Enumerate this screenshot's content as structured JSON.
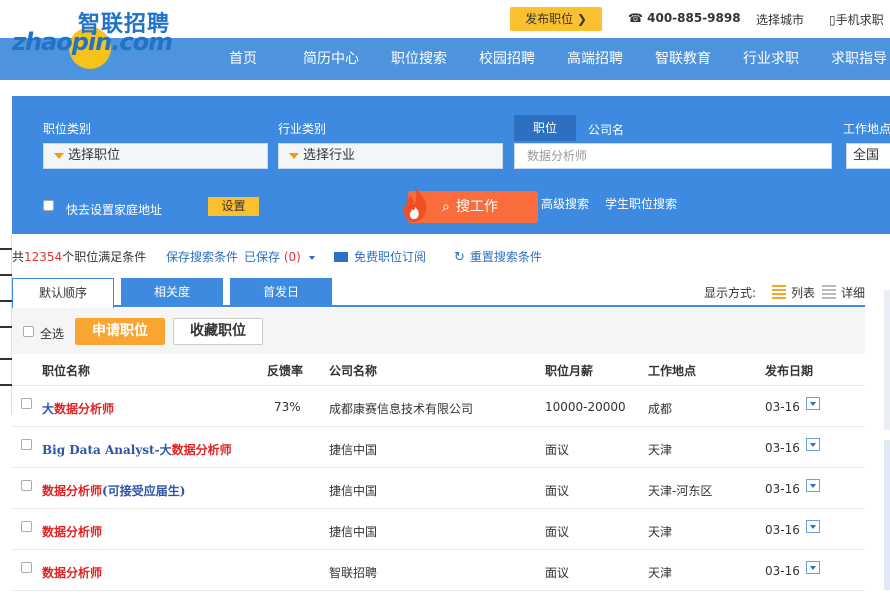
{
  "header": {
    "logo_cn": "智联招聘",
    "logo_en": "zhaopin.com",
    "post_job": "发布职位 ❯",
    "phone": "☎ 400-885-9898",
    "city": "选择城市",
    "mobile": "▯手机求职"
  },
  "nav": [
    "首页",
    "简历中心",
    "职位搜索",
    "校园招聘",
    "高端招聘",
    "智联教育",
    "行业求职",
    "求职指导"
  ],
  "search": {
    "job_category_label": "职位类别",
    "job_category_value": "选择职位",
    "industry_label": "行业类别",
    "industry_value": "选择行业",
    "tab_job": "职位",
    "tab_company": "公司名",
    "keyword_value": "数据分析师",
    "location_label": "工作地点",
    "location_value": "全国",
    "home_label": "快去设置家庭地址",
    "set_button": "设置",
    "search_button": "搜工作",
    "advanced": "高级搜索",
    "student": "学生职位搜索"
  },
  "summary": {
    "prefix": "共",
    "count": "12354",
    "suffix": "个职位满足条件",
    "save_condition": "保存搜索条件",
    "saved_label": "已保存",
    "saved_count": "(0)",
    "subscribe": "免费职位订阅",
    "reset": "重置搜索条件"
  },
  "tabs": [
    "默认顺序",
    "相关度",
    "首发日"
  ],
  "display": {
    "label": "显示方式:",
    "list": "列表",
    "detail": "详细"
  },
  "actions": {
    "select_all": "全选",
    "apply": "申请职位",
    "favorite": "收藏职位"
  },
  "table": {
    "headers": [
      "职位名称",
      "反馈率",
      "公司名称",
      "职位月薪",
      "工作地点",
      "发布日期"
    ],
    "rows": [
      {
        "title_pre": "大",
        "title_hl": "数据分析师",
        "title_post": "",
        "feedback": "73%",
        "company": "成都康赛信息技术有限公司",
        "salary": "10000-20000",
        "location": "成都",
        "date": "03-16"
      },
      {
        "title_pre": "Big Data Analyst-大",
        "title_hl": "数据分析师",
        "title_post": "",
        "feedback": "",
        "company": "捷信中国",
        "salary": "面议",
        "location": "天津",
        "date": "03-16"
      },
      {
        "title_pre": "",
        "title_hl": "数据分析师",
        "title_post": "(可接受应届生)",
        "feedback": "",
        "company": "捷信中国",
        "salary": "面议",
        "location": "天津-河东区",
        "date": "03-16"
      },
      {
        "title_pre": "",
        "title_hl": "数据分析师",
        "title_post": "",
        "feedback": "",
        "company": "捷信中国",
        "salary": "面议",
        "location": "天津",
        "date": "03-16"
      },
      {
        "title_pre": "",
        "title_hl": "数据分析师",
        "title_post": "",
        "feedback": "",
        "company": "智联招聘",
        "salary": "面议",
        "location": "天津",
        "date": "03-16"
      }
    ]
  },
  "colors": {
    "primary_blue": "#3d8ae0",
    "nav_blue": "#4d93dd",
    "accent_yellow": "#fbc02d",
    "search_orange": "#fb6c3c",
    "highlight_red": "#e02222"
  }
}
